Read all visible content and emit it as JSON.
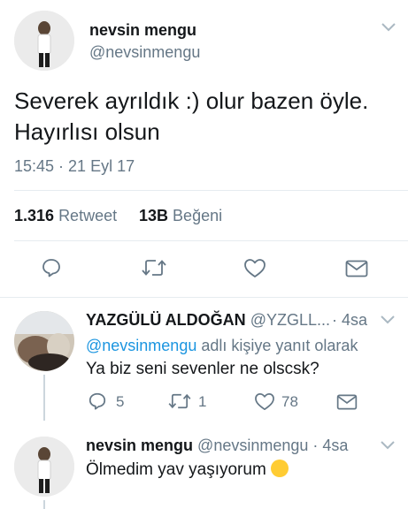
{
  "main_tweet": {
    "author_name": "nevsin mengu",
    "author_handle": "@nevsinmengu",
    "text_line1": "Severek ayrıldık :) olur bazen öyle.",
    "text_line2": "Hayırlısı olsun",
    "timestamp": "15:45 · 21 Eyl 17",
    "retweet_count": "1.316",
    "retweet_label": "Retweet",
    "like_count": "13B",
    "like_label": "Beğeni"
  },
  "replies": [
    {
      "author_name": "YAZGÜLÜ ALDOĞAN",
      "author_handle": "@YZGLL...",
      "time": "· 4sa",
      "reply_to_handle": "@nevsinmengu",
      "reply_to_suffix": "adlı kişiye yanıt olarak",
      "text": "Ya biz seni sevenler ne olscsk?",
      "reply_count": "5",
      "retweet_count": "1",
      "like_count": "78"
    },
    {
      "author_name": "nevsin mengu",
      "author_handle": "@nevsinmengu",
      "time": "· 4sa",
      "text": "Ölmedim yav yaşıyorum",
      "emoji": "😀"
    }
  ]
}
